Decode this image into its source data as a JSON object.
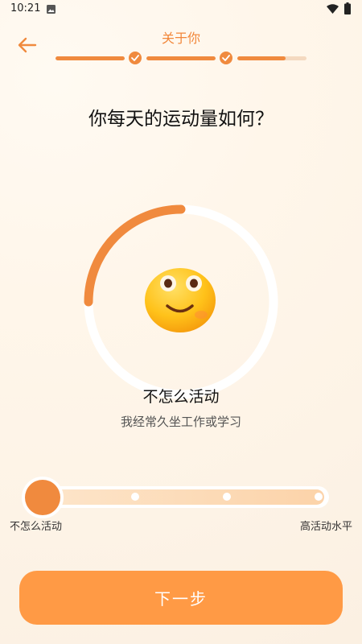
{
  "status_bar": {
    "time": "10:21",
    "icons": [
      "gallery-icon",
      "wifi-icon",
      "battery-icon"
    ]
  },
  "header": {
    "title": "关于你",
    "back_icon": "arrow-left-icon"
  },
  "stepper": {
    "steps_completed": 2,
    "current_step_progress": 0.7
  },
  "question": "你每天的运动量如何？",
  "gauge": {
    "level_fraction": 0.25,
    "emoji": "smiling-face-icon"
  },
  "selection": {
    "title": "不怎么活动",
    "description": "我经常久坐工作或学习"
  },
  "slider": {
    "min_label": "不怎么活动",
    "max_label": "高活动水平",
    "stops": 4,
    "selected_index": 0
  },
  "next_button": {
    "label": "下一步"
  },
  "colors": {
    "accent": "#f08a3e",
    "button": "#ff9a45",
    "track_light": "#fcd3a9"
  }
}
